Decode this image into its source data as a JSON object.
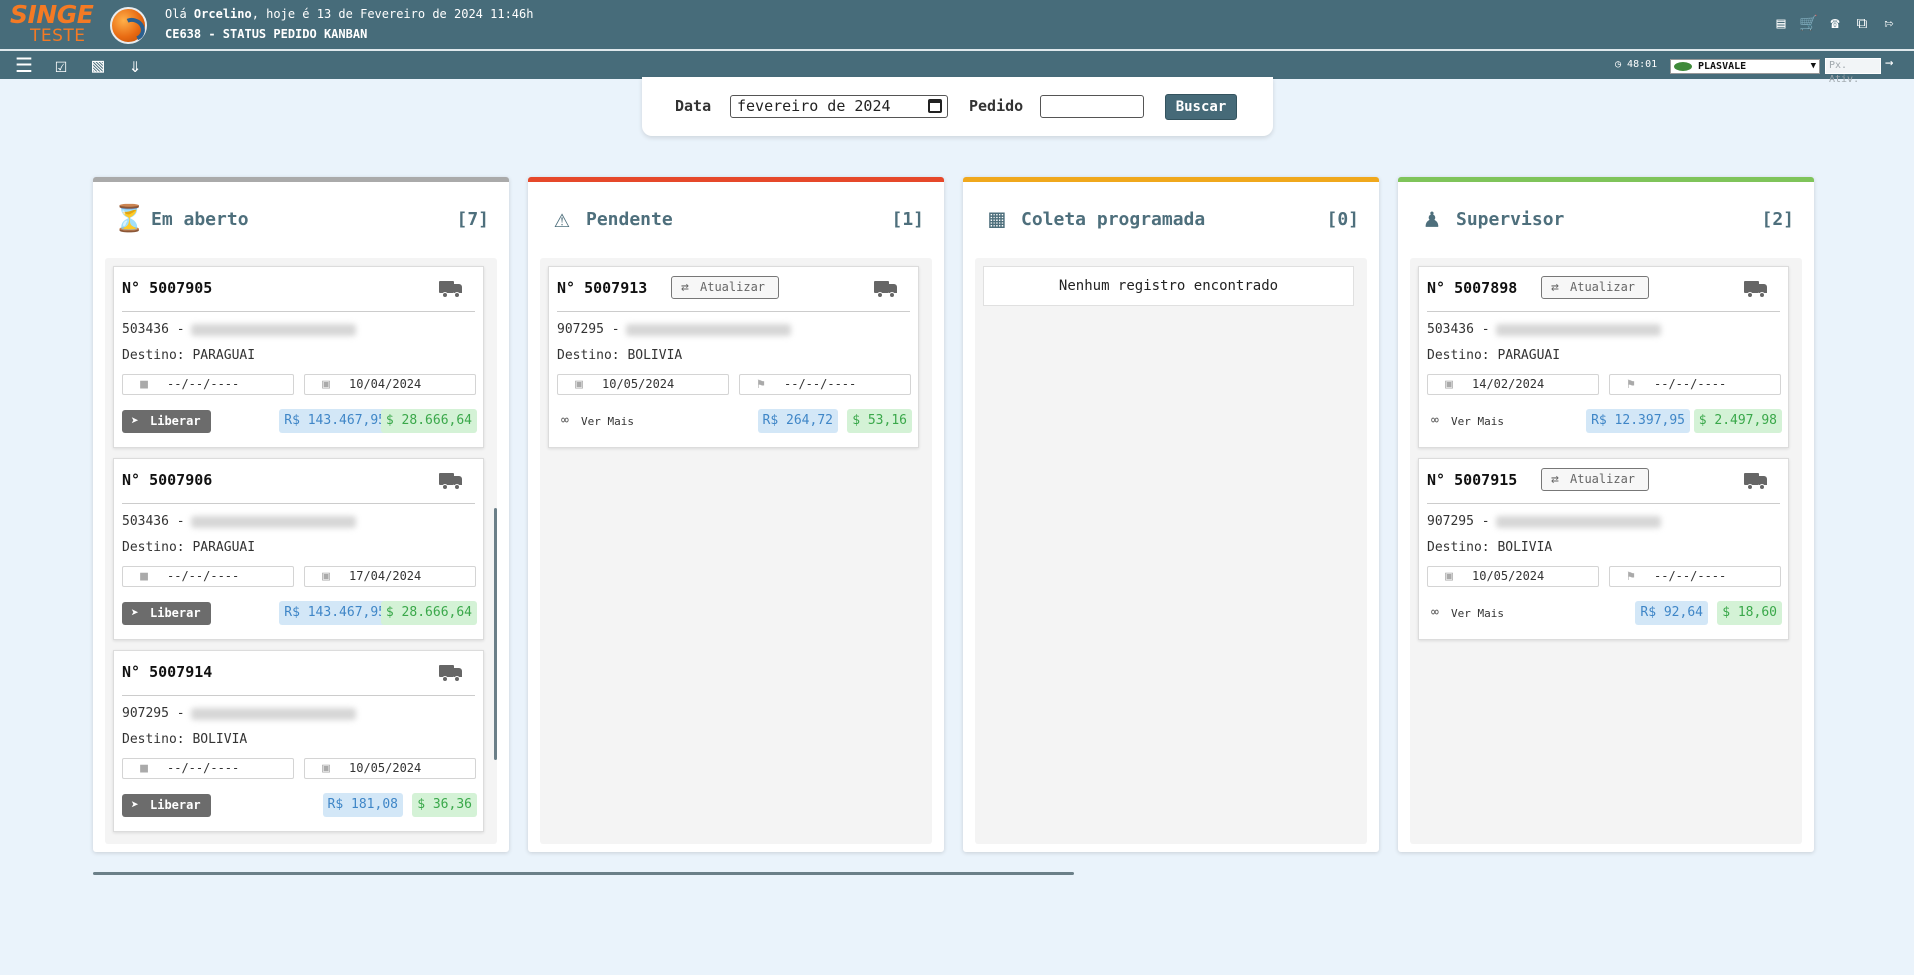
{
  "header": {
    "brand_top": "SINGE",
    "brand_bottom": "TESTE",
    "greeting_prefix": "Olá",
    "user": "Orcelino",
    "greeting_suffix": ", hoje é 13 de Fevereiro de 2024 11:46h",
    "screen_title": "CE638 - STATUS PEDIDO KANBAN",
    "icons": [
      "report-icon",
      "cart-icon",
      "chat-phone-icon",
      "windows-icon",
      "exit-icon"
    ]
  },
  "toolbar": {
    "icons": [
      "menu-list-icon",
      "checklist-icon",
      "form-icon",
      "double-chevron-down-icon"
    ],
    "clock": "48:01",
    "company": "PLASVALE",
    "next_placeholder": "Px. Ativ."
  },
  "filter": {
    "date_label": "Data",
    "date_value": "fevereiro de 2024",
    "order_label": "Pedido",
    "order_value": "",
    "search_label": "Buscar"
  },
  "columns": [
    {
      "title": "Em aberto",
      "count": "[7]",
      "accent": "#aaaaaa",
      "cards": [
        {
          "number": "N° 5007905",
          "client_code": "503436 -",
          "destination": "Destino: PARAGUAI",
          "date1": "--/--/----",
          "date2": "10/04/2024",
          "action": "Liberar",
          "brl": "R$ 143.467,95",
          "usd": "$ 28.666,64"
        },
        {
          "number": "N° 5007906",
          "client_code": "503436 -",
          "destination": "Destino: PARAGUAI",
          "date1": "--/--/----",
          "date2": "17/04/2024",
          "action": "Liberar",
          "brl": "R$ 143.467,95",
          "usd": "$ 28.666,64"
        },
        {
          "number": "N° 5007914",
          "client_code": "907295 -",
          "destination": "Destino: BOLIVIA",
          "date1": "--/--/----",
          "date2": "10/05/2024",
          "action": "Liberar",
          "brl": "R$ 181,08",
          "usd": "$ 36,36"
        }
      ]
    },
    {
      "title": "Pendente",
      "count": "[1]",
      "accent": "#e6482a",
      "cards": [
        {
          "number": "N° 5007913",
          "update": "Atualizar",
          "client_code": "907295 -",
          "destination": "Destino: BOLIVIA",
          "date1": "10/05/2024",
          "date2": "--/--/----",
          "action": "Ver Mais",
          "brl": "R$ 264,72",
          "usd": "$ 53,16"
        }
      ]
    },
    {
      "title": "Coleta programada",
      "count": "[0]",
      "accent": "#f0a81c",
      "empty": "Nenhum registro encontrado"
    },
    {
      "title": "Supervisor",
      "count": "[2]",
      "accent": "#7fc45a",
      "cards": [
        {
          "number": "N° 5007898",
          "update": "Atualizar",
          "client_code": "503436 -",
          "destination": "Destino: PARAGUAI",
          "date1": "14/02/2024",
          "date2": "--/--/----",
          "action": "Ver Mais",
          "brl": "R$ 12.397,95",
          "usd": "$ 2.497,98"
        },
        {
          "number": "N° 5007915",
          "update": "Atualizar",
          "client_code": "907295 -",
          "destination": "Destino: BOLIVIA",
          "date1": "10/05/2024",
          "date2": "--/--/----",
          "action": "Ver Mais",
          "brl": "R$ 92,64",
          "usd": "$ 18,60"
        }
      ]
    }
  ]
}
